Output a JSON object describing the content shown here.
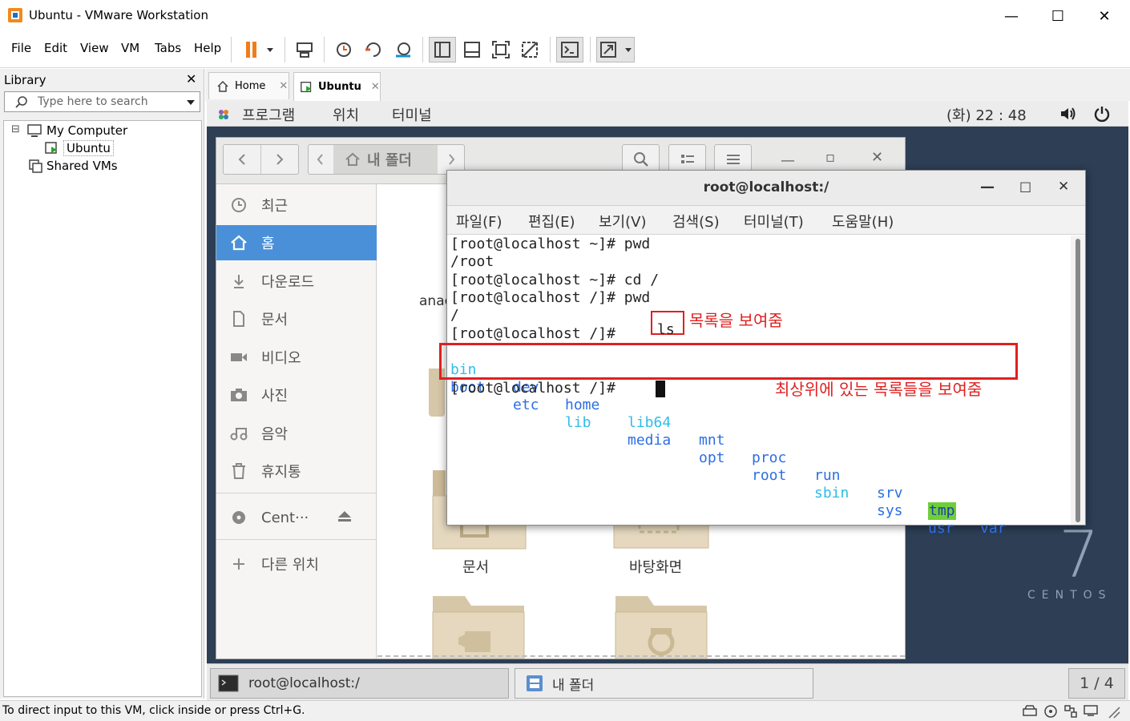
{
  "window": {
    "title": "Ubuntu - VMware Workstation",
    "minimize": "—",
    "maximize": "☐",
    "close": "✕"
  },
  "menu": {
    "file": "File",
    "edit": "Edit",
    "view": "View",
    "vm": "VM",
    "tabs": "Tabs",
    "help": "Help"
  },
  "library": {
    "title": "Library",
    "close": "✕",
    "search_placeholder": "Type here to search",
    "tree": {
      "expander": "⊟",
      "my_computer": "My Computer",
      "ubuntu": "Ubuntu",
      "shared": "Shared VMs"
    }
  },
  "tabs": [
    {
      "label": "Home",
      "close": "✕"
    },
    {
      "label": "Ubuntu",
      "close": "✕"
    }
  ],
  "guest": {
    "topbar": {
      "programs": "프로그램",
      "places": "위치",
      "terminal": "터미널",
      "clock": "(화) 22 : 48"
    },
    "files": {
      "location": "내 폴더",
      "sidebar": [
        "최근",
        "홈",
        "다운로드",
        "문서",
        "비디오",
        "사진",
        "음악",
        "휴지통"
      ],
      "device": "Cent···",
      "other": "다른 위치",
      "folders": {
        "documents": "문서",
        "desktop": "바탕화면",
        "partial": "anac"
      }
    },
    "terminal": {
      "title": "root@localhost:/",
      "minimize": "—",
      "maximize": "□",
      "close": "✕",
      "menu": [
        "파일(F)",
        "편집(E)",
        "보기(V)",
        "검색(S)",
        "터미널(T)",
        "도움말(H)"
      ],
      "lines": [
        "[root@localhost ~]# pwd",
        "/root",
        "[root@localhost ~]# cd /",
        "[root@localhost /]# pwd",
        "/",
        "[root@localhost /]# "
      ],
      "ls_cmd": "ls",
      "prompt_last": "[root@localhost /]# ",
      "ls_row1": [
        "bin",
        "dev",
        "home",
        "lib64",
        "mnt",
        "proc",
        "run",
        "srv",
        "tmp",
        "var"
      ],
      "ls_row2": [
        "boot",
        "etc",
        "lib",
        "media",
        "opt",
        "root",
        "sbin",
        "sys",
        "usr"
      ],
      "annotation_ls": "목록을 보여줌",
      "annotation_root": "최상위에 있는 목록들을 보여줌"
    },
    "centos": {
      "version": "7",
      "brand": "CENTOS"
    },
    "taskbar": {
      "terminal": "root@localhost:/",
      "files": "내 폴더",
      "workspace": "1 / 4"
    }
  },
  "status": {
    "text": "To direct input to this VM, click inside or press Ctrl+G."
  },
  "colors": {
    "selection": "#4a90d9",
    "annotation": "#e02020",
    "tmp_highlight": "#6fcf3a"
  }
}
